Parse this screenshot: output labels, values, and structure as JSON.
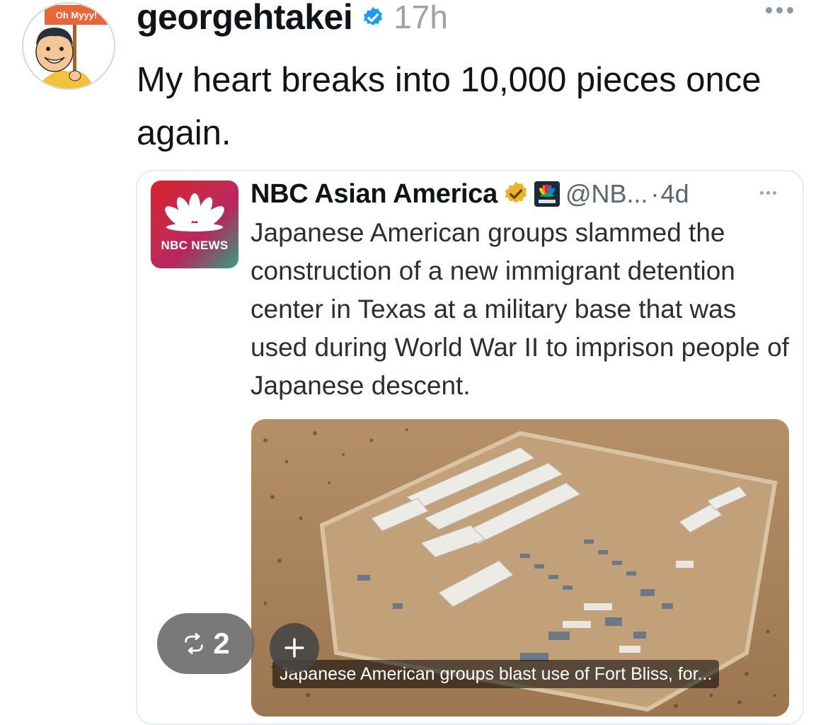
{
  "post": {
    "username": "georgehtakei",
    "timestamp": "17h",
    "text": "My heart breaks into 10,000 pieces once again.",
    "avatar_sign_text": "Oh Myyy!"
  },
  "quoted_post": {
    "logo_text": "NBC NEWS",
    "name": "NBC Asian America",
    "handle": "@NB...",
    "separator": "·",
    "time": "4d",
    "text": "Japanese American groups slammed the construction of a new immigrant detention center in Texas at a military base that was used during World War II to imprison people of Japanese descent.",
    "media_caption": "Japanese American groups blast use of Fort Bliss, for..."
  },
  "actions": {
    "repost_count": "2",
    "add_icon": "plus-icon",
    "repost_icon": "repost-icon"
  },
  "colors": {
    "verified_blue": "#1d9bf0",
    "gold_badge": "#e8b52c",
    "text_primary": "#0f1419",
    "text_secondary": "#5b6670"
  }
}
